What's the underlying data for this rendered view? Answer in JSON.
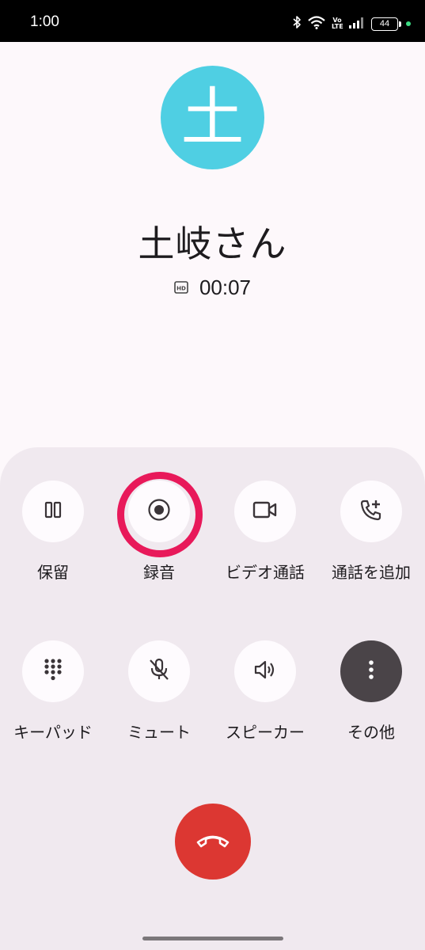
{
  "status_bar": {
    "time": "1:00",
    "network_label_top": "Vo",
    "network_label_bottom": "LTE",
    "battery_level": "44",
    "icons": [
      "bluetooth-icon",
      "wifi-icon",
      "volte-icon",
      "signal-icon",
      "battery-icon",
      "charging-dot-icon"
    ]
  },
  "contact": {
    "avatar_initial": "土",
    "name": "土岐さん",
    "avatar_color": "#4fcfe3"
  },
  "call": {
    "hd_icon": "hd-icon",
    "timer": "00:07"
  },
  "controls": {
    "hold": {
      "label": "保留",
      "icon": "pause-icon"
    },
    "record": {
      "label": "録音",
      "icon": "record-icon",
      "highlighted": true,
      "highlight_color": "#e8195a"
    },
    "video": {
      "label": "ビデオ通話",
      "icon": "video-camera-icon"
    },
    "add_call": {
      "label": "通話を追加",
      "icon": "add-call-icon"
    },
    "keypad": {
      "label": "キーパッド",
      "icon": "dialpad-icon"
    },
    "mute": {
      "label": "ミュート",
      "icon": "mic-off-icon"
    },
    "speaker": {
      "label": "スピーカー",
      "icon": "speaker-icon"
    },
    "more": {
      "label": "その他",
      "icon": "more-vertical-icon"
    }
  },
  "end_call": {
    "icon": "hang-up-icon",
    "color": "#dc3732"
  }
}
